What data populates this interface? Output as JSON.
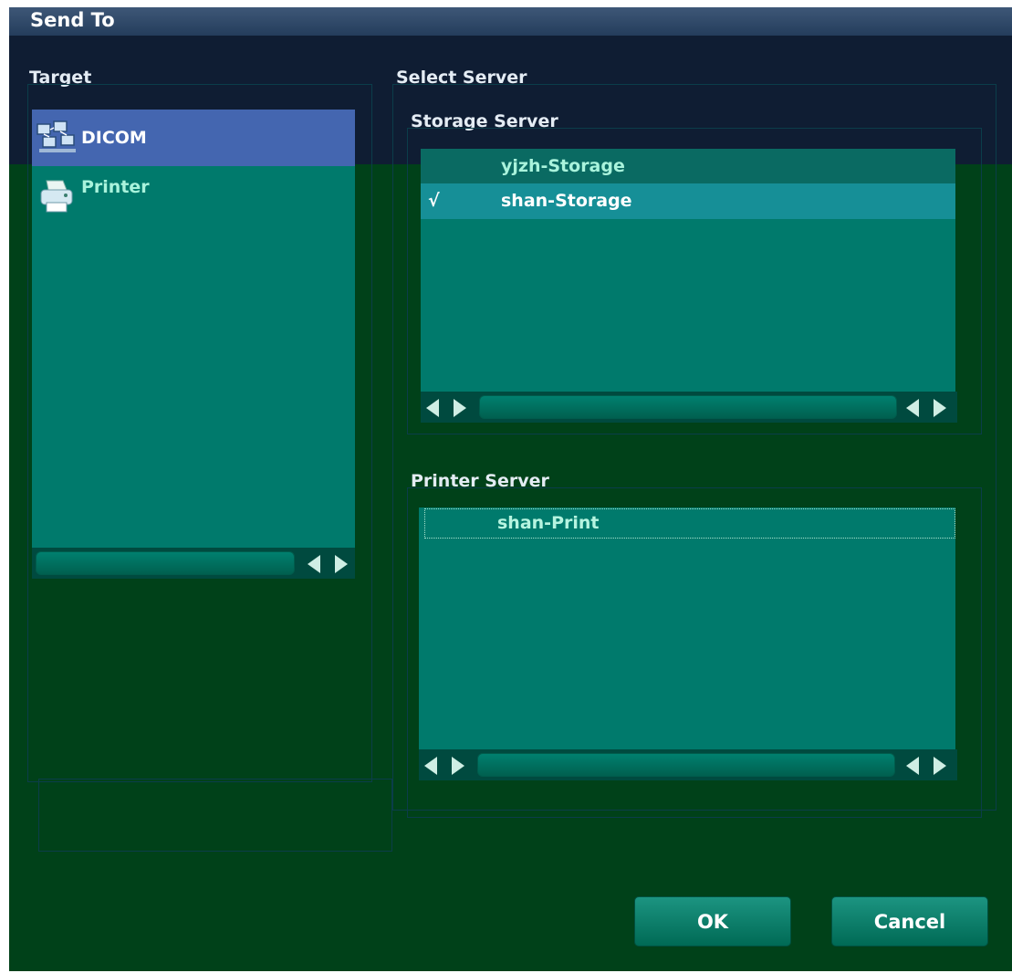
{
  "window": {
    "title": "Send To"
  },
  "target": {
    "label": "Target",
    "items": [
      {
        "label": "DICOM",
        "icon": "dicom-network-icon",
        "selected": true
      },
      {
        "label": "Printer",
        "icon": "printer-icon",
        "selected": false
      }
    ]
  },
  "select_server": {
    "label": "Select Server",
    "storage": {
      "label": "Storage Server",
      "items": [
        {
          "check": "",
          "label": "yjzh-Storage"
        },
        {
          "check": "√",
          "label": "shan-Storage"
        }
      ]
    },
    "printer": {
      "label": "Printer Server",
      "items": [
        {
          "label": "shan-Print"
        }
      ]
    }
  },
  "buttons": {
    "ok": "OK",
    "cancel": "Cancel"
  },
  "colors": {
    "dialog_bg": "#004119",
    "list_bg": "#007a6c",
    "selected_row": "#4466b0",
    "checked_row": "#168f97",
    "title_bar": "#2f4868"
  }
}
